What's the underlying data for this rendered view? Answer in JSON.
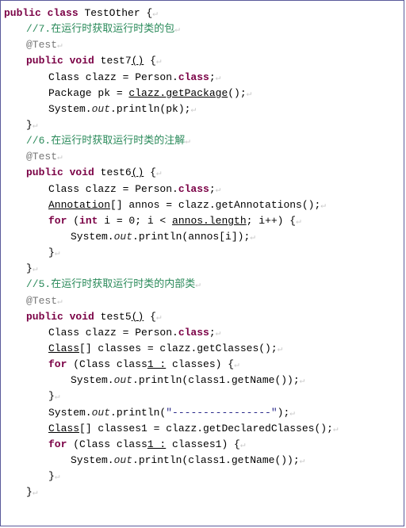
{
  "class_decl": {
    "kw_public": "public",
    "kw_class": "class",
    "name": "TestOther",
    "brace": " {"
  },
  "c7": "//7.在运行时获取运行时类的包",
  "anno": "@Test",
  "m7": {
    "sig_public": "public",
    "sig_void": "void",
    "sig_name": " test7",
    "sig_after": "()",
    "sig_brace": "{",
    "l1_a": "Class clazz = Person.",
    "l1_b": "class",
    "l1_c": ";",
    "l2_a": "Package pk = ",
    "l2_b": "clazz.getPackage",
    "l2_c": "();",
    "l3_a": "System.",
    "l3_b": "out",
    "l3_c": ".println(pk);",
    "close": "}"
  },
  "c6": "//6.在运行时获取运行时类的注解",
  "m6": {
    "sig_name": " test6",
    "l1_a": "Class clazz = Person.",
    "l1_b": "class",
    "l1_c": ";",
    "l2_a": "Annotation",
    "l2_b": "[] annos = clazz.getAnnotations();",
    "l3_for": "for",
    "l3_a": " (",
    "l3_int": "int",
    "l3_b": " i = 0; i < ",
    "l3_c": "annos.length",
    "l3_d": "; i++) {",
    "l4_a": "System.",
    "l4_b": "out",
    "l4_c": ".println(annos[i]);",
    "inner_close": "}",
    "close": "}"
  },
  "c5": "//5.在运行时获取运行时类的内部类",
  "m5": {
    "sig_name": " test5",
    "l1_a": "Class clazz = Person.",
    "l1_b": "class",
    "l1_c": ";",
    "l2_a": "Class",
    "l2_b": "[] classes = clazz.getClasses();",
    "l3_for": "for",
    "l3_a": " (Class class",
    "l3_b": "1 :",
    "l3_c": " classes) {",
    "l4_a": "System.",
    "l4_b": "out",
    "l4_c": ".println(class1.getName());",
    "inner_close": "}",
    "l5_a": "System.",
    "l5_b": "out",
    "l5_c": ".println(",
    "l5_d": "\"----------------\"",
    "l5_e": ");",
    "l6_a": "Class",
    "l6_b": "[] classes1 = clazz.getDeclaredClasses();",
    "l7_for": "for",
    "l7_a": " (Class class",
    "l7_b": "1 :",
    "l7_c": " classes1) {",
    "l8_a": "System.",
    "l8_b": "out",
    "l8_c": ".println(class1.getName());",
    "inner_close2": "}",
    "close": "}"
  },
  "para": "↵"
}
